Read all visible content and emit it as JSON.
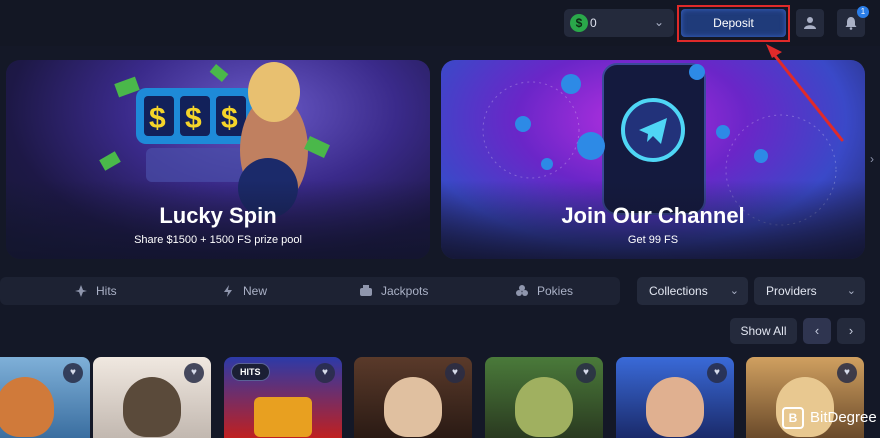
{
  "header": {
    "balance": {
      "currency_icon": "dollar-coin-icon",
      "amount": "0"
    },
    "deposit_label": "Deposit",
    "notification_count": "1"
  },
  "banners": [
    {
      "title": "Lucky Spin",
      "subtitle": "Share $1500 + 1500 FS prize pool"
    },
    {
      "title": "Join Our Channel",
      "subtitle": "Get 99 FS"
    }
  ],
  "categories": [
    {
      "label": "Hits",
      "icon": "hits-icon"
    },
    {
      "label": "New",
      "icon": "new-icon"
    },
    {
      "label": "Jackpots",
      "icon": "jackpots-icon"
    },
    {
      "label": "Pokies",
      "icon": "pokies-icon"
    }
  ],
  "filters": {
    "collections_label": "Collections",
    "providers_label": "Providers"
  },
  "games": {
    "show_all_label": "Show All",
    "hits_badge": "HITS"
  },
  "watermark": {
    "brand": "BitDegree"
  },
  "colors": {
    "background": "#141827",
    "deposit_highlight": "#e02a2a",
    "accent": "#2a7de8"
  }
}
